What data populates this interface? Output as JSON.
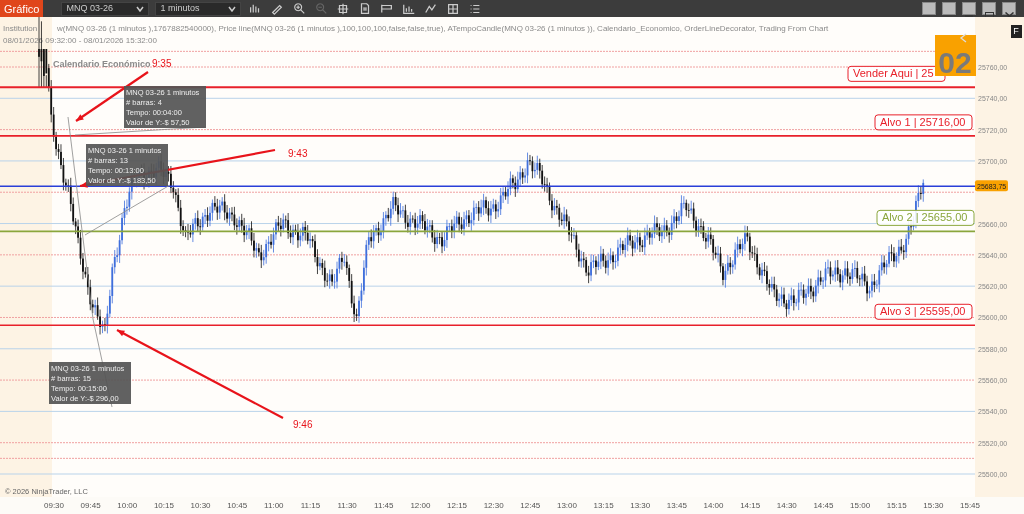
{
  "toolbar": {
    "tab": "Gráfico",
    "instrument": "MNQ 03-26",
    "interval": "1 minutos"
  },
  "chart": {
    "indicator_parts": [
      "Institution",
      "w(MNQ 03-26 (1 minutos ),1767882540000), Price line(MNQ 03-26 (1 minutos ),100,100,100,false,false,true), ATempoCandle(MNQ 03-26 (1 minutos )), Calendario_Economico, OrderLineDecorator, Trading From Chart"
    ],
    "date_range": "08/01/2026 09:32:00 - 08/01/2026 15:32:00",
    "calendar_label": "Calendario Económico",
    "time_marks": [
      {
        "text": "9:35"
      },
      {
        "text": "9:43"
      },
      {
        "text": "9:46"
      }
    ],
    "measurements": [
      {
        "lines": [
          "MNQ 03-26 1 minutos",
          "# barras:  4",
          "Tempo:     00:04:00",
          "Valor de Y:-$ 57,50"
        ]
      },
      {
        "lines": [
          "MNQ 03-26 1 minutos",
          "# barras:  13",
          "Tempo:     00:13:00",
          "Valor de Y:-$ 183,50"
        ]
      },
      {
        "lines": [
          "MNQ 03-26 1 minutos",
          "# barras:  15",
          "Tempo:     00:15:00",
          "Valor de Y:-$ 296,00"
        ]
      }
    ],
    "order_lines": [
      {
        "kind": "sell",
        "label": "Vender Aqui |  25",
        "color": "#e8202a"
      },
      {
        "kind": "target",
        "label": "Alvo 1 |  25716,00",
        "color": "#e8202a"
      },
      {
        "kind": "target",
        "label": "Alvo 2 |  25655,00",
        "color": "#8aa63c"
      },
      {
        "kind": "target",
        "label": "Alvo 3 |  25595,00",
        "color": "#e8202a"
      }
    ],
    "badge": "02",
    "price_tag": "25683,75",
    "copyright": "© 2026 NinjaTrader, LLC",
    "y_axis": [
      "25760,00",
      "25740,00",
      "25720,00",
      "25700,00",
      "25660,00",
      "25640,00",
      "25620,00",
      "25600,00",
      "25580,00",
      "25560,00",
      "25540,00",
      "25520,00",
      "25500,00"
    ],
    "x_axis": [
      "09:30",
      "09:45",
      "10:00",
      "10:15",
      "10:30",
      "10:45",
      "11:00",
      "11:15",
      "11:30",
      "11:45",
      "12:00",
      "12:15",
      "12:30",
      "12:45",
      "13:00",
      "13:15",
      "13:30",
      "13:45",
      "14:00",
      "14:15",
      "14:30",
      "14:45",
      "15:00",
      "15:15",
      "15:30",
      "15:45"
    ],
    "side_button": "F"
  }
}
